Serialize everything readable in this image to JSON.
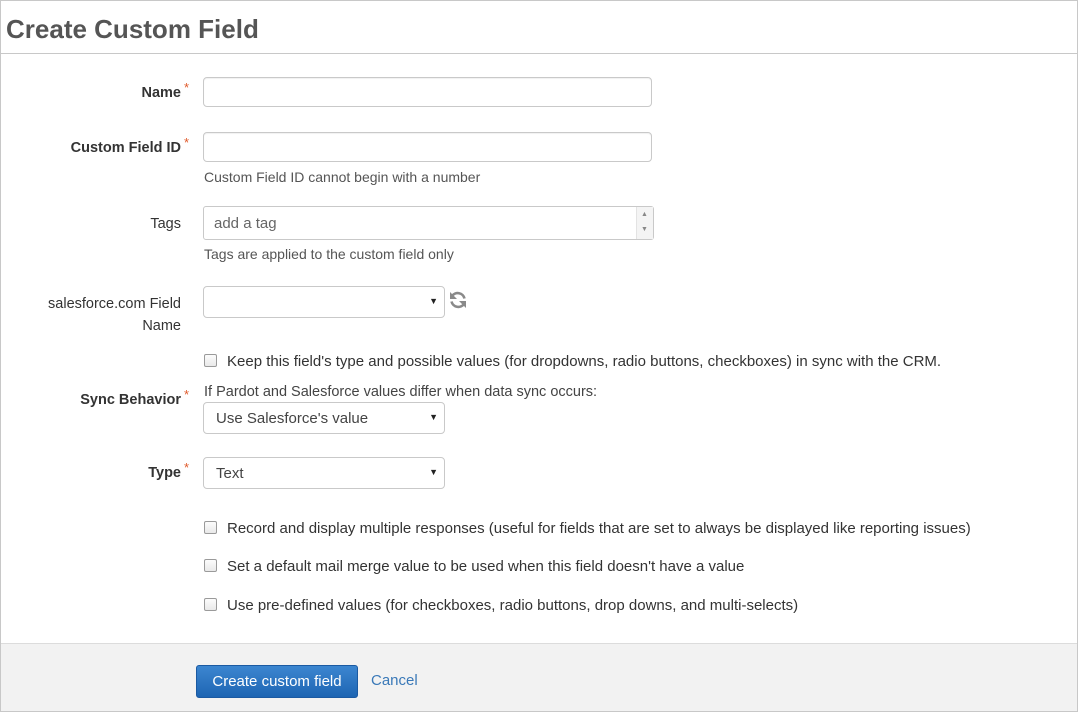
{
  "page": {
    "title": "Create Custom Field"
  },
  "form": {
    "name": {
      "label": "Name",
      "required_mark": "*",
      "value": ""
    },
    "custom_field_id": {
      "label": "Custom Field ID",
      "required_mark": "*",
      "value": "",
      "help": "Custom Field ID cannot begin with a number"
    },
    "tags": {
      "label": "Tags",
      "placeholder": "add a tag",
      "help": "Tags are applied to the custom field only"
    },
    "salesforce_field": {
      "label_line1": "salesforce.com Field",
      "label_line2": "Name",
      "value": "",
      "refresh_icon": "refresh-icon"
    },
    "keep_sync": {
      "label": "Keep this field's type and possible values (for dropdowns, radio buttons, checkboxes) in sync with the CRM.",
      "checked": false
    },
    "sync_behavior": {
      "label": "Sync Behavior",
      "required_mark": "*",
      "hint": "If Pardot and Salesforce values differ when data sync occurs:",
      "value": "Use Salesforce's value"
    },
    "type": {
      "label": "Type",
      "required_mark": "*",
      "value": "Text"
    },
    "options": [
      {
        "label": "Record and display multiple responses (useful for fields that are set to always be displayed like reporting issues)",
        "checked": false
      },
      {
        "label": "Set a default mail merge value to be used when this field doesn't have a value",
        "checked": false
      },
      {
        "label": "Use pre-defined values (for checkboxes, radio buttons, drop downs, and multi-selects)",
        "checked": false
      }
    ]
  },
  "footer": {
    "submit_label": "Create custom field",
    "cancel_label": "Cancel"
  },
  "colors": {
    "primary": "#2a74c1",
    "required": "#e05a2b",
    "link": "#3a79b8"
  }
}
